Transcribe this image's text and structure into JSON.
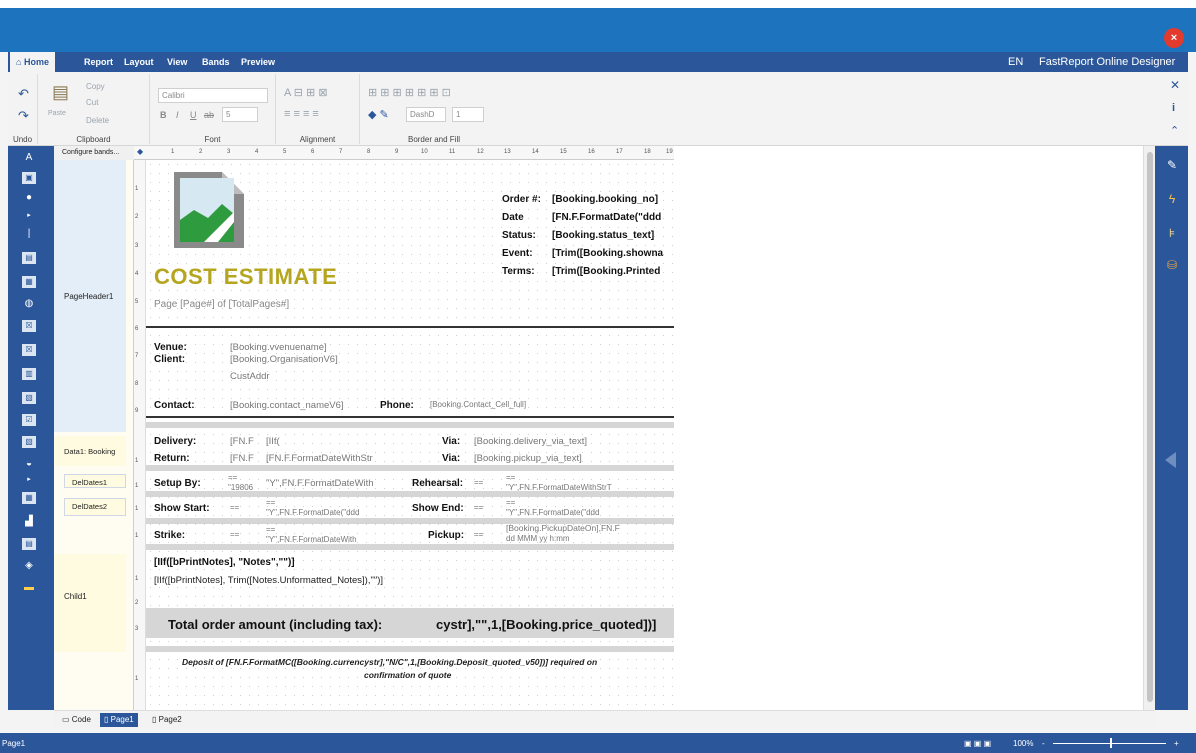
{
  "app": {
    "title": "FastReport Online Designer",
    "language": "EN",
    "close_glyph": "×"
  },
  "menu": {
    "tabs": [
      "Home",
      "Report",
      "Layout",
      "View",
      "Bands",
      "Preview"
    ]
  },
  "ribbon": {
    "undo_label": "Undo",
    "clipboard": {
      "paste": "Paste",
      "copy": "Copy",
      "cut": "Cut",
      "delete": "Delete",
      "group": "Clipboard"
    },
    "font": {
      "name": "Calibri",
      "size": "5",
      "group": "Font"
    },
    "alignment": {
      "group": "Alignment"
    },
    "border": {
      "dash": "DashD",
      "width": "1",
      "group": "Border and Fill"
    }
  },
  "bands": {
    "header": "Configure bands...",
    "items": [
      "PageHeader1",
      "Data1: Booking",
      "DelDates1",
      "DelDates2",
      "iates3",
      "Child1"
    ]
  },
  "report": {
    "title": "COST ESTIMATE",
    "page_expr": "Page [Page#] of [TotalPages#]",
    "header_labels": [
      "Order #:",
      "Date",
      "Status:",
      "Event:",
      "Terms:"
    ],
    "header_values": [
      "[Booking.booking_no]",
      "[FN.F.FormatDate(\"ddd",
      "[Booking.status_text]",
      "[Trim([Booking.showna",
      "[Trim([Booking.Printed"
    ],
    "venue_label": "Venue:",
    "client_label": "Client:",
    "venue_value": "[Booking.vvenuename]",
    "client_value": "[Booking.OrganisationV6]",
    "custaddr": "CustAddr",
    "contact_label": "Contact:",
    "contact_value": "[Booking.contact_nameV6]",
    "phone_label": "Phone:",
    "phone_value": "[Booking.Contact_Cell_full]",
    "delivery_label": "Delivery:",
    "return_label": "Return:",
    "delivery_v1": "[FN.F",
    "delivery_v2": "[IIf(",
    "return_v1": "[FN.F",
    "return_v2": "[FN.F.FormatDateWithStr",
    "via_label": "Via:",
    "delivery_via": "[Booking.delivery_via_text]",
    "pickup_via": "[Booking.pickup_via_text]",
    "setup_label": "Setup By:",
    "setup_v1": "==",
    "setup_v1b": "\"19806",
    "setup_v2": "\"Y\",FN.F.FormatDateWith",
    "rehearsal_label": "Rehearsal:",
    "rehearsal_v1": "==",
    "rehearsal_v2": "==",
    "rehearsal_v2b": "\"Y\",FN.F.FormatDateWithStrT",
    "showstart_label": "Show Start:",
    "showstart_v1": "==",
    "showstart_v2": "==",
    "showstart_v2b": "\"Y\",FN.F.FormatDate(\"ddd",
    "showend_label": "Show End:",
    "showend_v1": "==",
    "showend_v2": "==",
    "showend_v2b": "\"Y\",FN.F.FormatDate(\"ddd",
    "strike_label": "Strike:",
    "strike_v1": "==",
    "strike_v2": "==",
    "strike_v2b": "\"Y\",FN.F.FormatDateWith",
    "pickup_label": "Pickup:",
    "pickup_v1": "==",
    "pickup_v2": "[Booking.PickupDateOn],FN.F",
    "pickup_v2b": "dd MMM yy h:mm",
    "notes_heading": "[IIf([bPrintNotes], \"Notes\",\"\")]",
    "notes_body": "[IIf([bPrintNotes], Trim([Notes.Unformatted_Notes]),\"\")]",
    "total_label": "Total order amount (including tax):",
    "total_value": "cystr],\"\",1,[Booking.price_quoted])]",
    "deposit_line1": "Deposit of [FN.F.FormatMC([Booking.currencystr],\"N/C\",1,[Booking.Deposit_quoted_v50])] required on",
    "deposit_line2": "confirmation of quote"
  },
  "ruler": {
    "top": [
      "1",
      "2",
      "3",
      "4",
      "5",
      "6",
      "7",
      "8",
      "9",
      "10",
      "11",
      "12",
      "13",
      "14",
      "15",
      "16",
      "17",
      "18",
      "19"
    ],
    "side": [
      "1",
      "2",
      "3",
      "4",
      "5",
      "6",
      "7",
      "8",
      "9",
      "1",
      "1",
      "1",
      "1",
      "1",
      "2",
      "3",
      "1"
    ]
  },
  "tabs": [
    "Code",
    "Page1",
    "Page2"
  ],
  "status": {
    "page": "Page1",
    "zoom": "100%"
  },
  "colors": {
    "title_gold": "#b5a51f",
    "accent": "#2b579a",
    "titlebar": "#1e73be"
  }
}
